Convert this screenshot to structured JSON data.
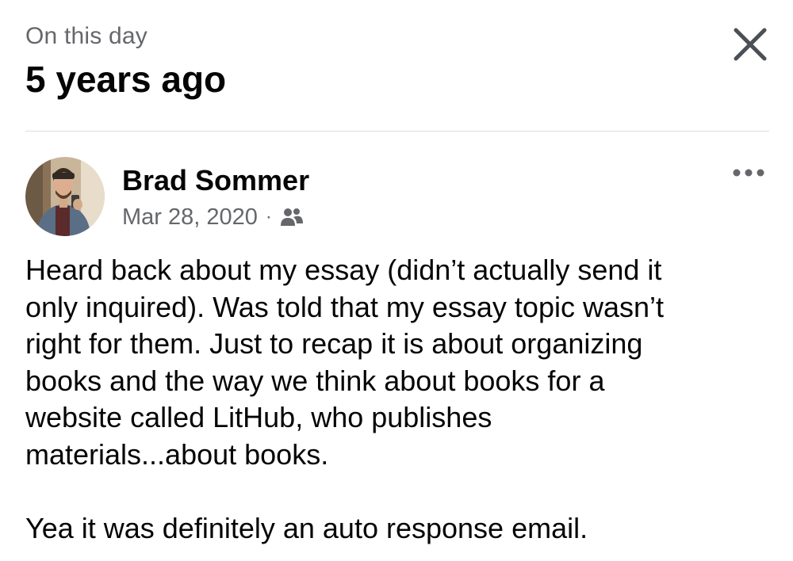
{
  "header": {
    "kicker": "On this day",
    "title": "5 years ago"
  },
  "post": {
    "author": "Brad Sommer",
    "date": "Mar 28, 2020",
    "separator": "·",
    "audience_icon": "friends-icon",
    "more_icon": "more-horizontal-icon",
    "paragraphs": [
      "Heard back about my essay (didn’t actually send it\nonly inquired). Was told that my essay topic wasn’t\nright for them. Just to recap it is about organizing\nbooks and the way we think about books for a\nwebsite called LitHub, who publishes\nmaterials...about books.",
      "Yea it was definitely an auto response email."
    ]
  },
  "icons": {
    "close": "close-icon"
  },
  "colors": {
    "text_primary": "#050505",
    "text_secondary": "#65676b",
    "divider": "#dadde1"
  }
}
